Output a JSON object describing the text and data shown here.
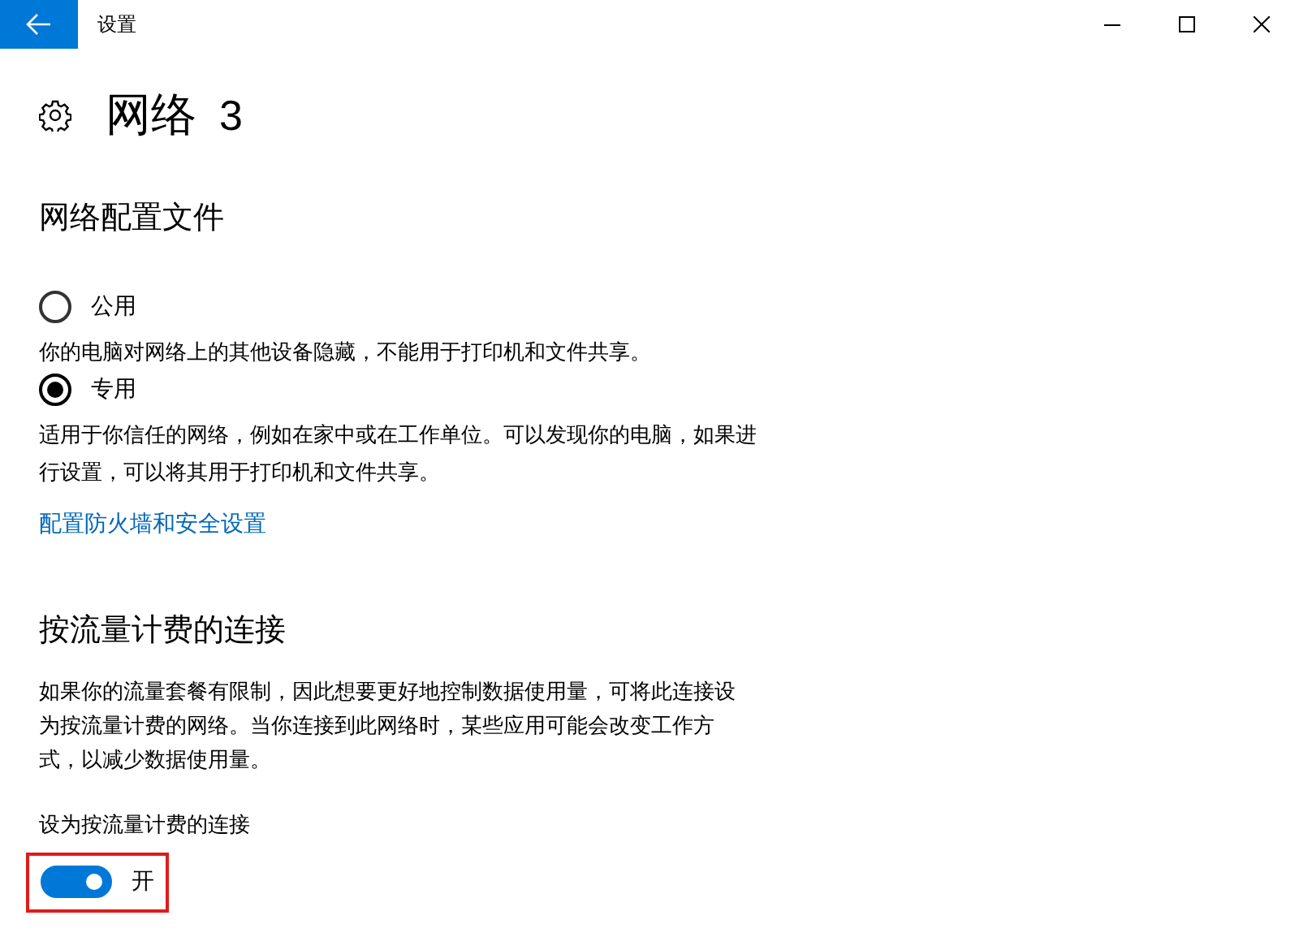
{
  "window": {
    "title": "设置"
  },
  "header": {
    "title": "网络",
    "number": "3"
  },
  "profile": {
    "heading": "网络配置文件",
    "options": [
      {
        "label": "公用",
        "selected": false,
        "description": "你的电脑对网络上的其他设备隐藏，不能用于打印机和文件共享。"
      },
      {
        "label": "专用",
        "selected": true,
        "description": "适用于你信任的网络，例如在家中或在工作单位。可以发现你的电脑，如果进行设置，可以将其用于打印机和文件共享。"
      }
    ],
    "link": "配置防火墙和安全设置"
  },
  "metered": {
    "heading": "按流量计费的连接",
    "description": "如果你的流量套餐有限制，因此想要更好地控制数据使用量，可将此连接设为按流量计费的网络。当你连接到此网络时，某些应用可能会改变工作方式，以减少数据使用量。",
    "toggle": {
      "label": "设为按流量计费的连接",
      "on": true,
      "state_text": "开",
      "highlighted": true
    }
  }
}
